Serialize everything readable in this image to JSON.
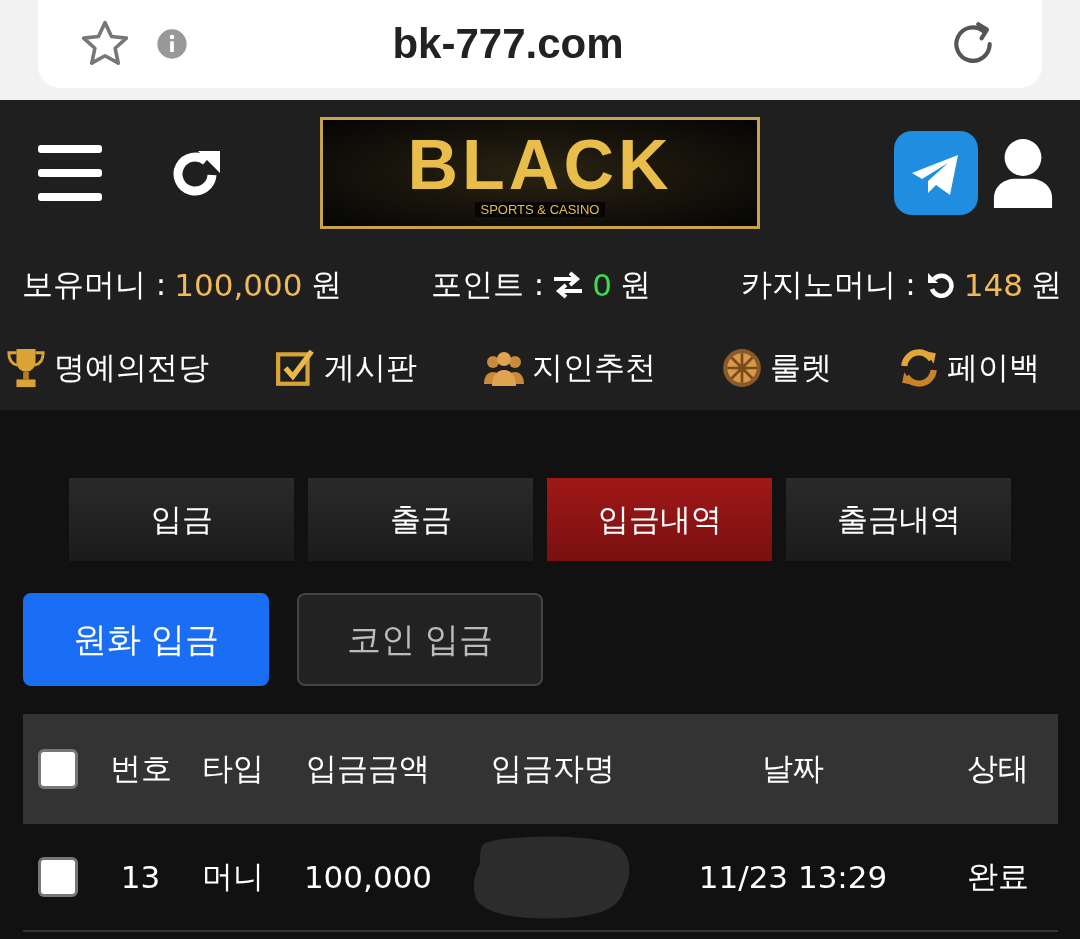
{
  "browser": {
    "url": "bk-777.com"
  },
  "logo": {
    "title": "BLACK",
    "subtitle": "SPORTS & CASINO"
  },
  "balances": [
    {
      "label": "보유머니 :",
      "value": "100,000",
      "unit": "원",
      "kind": "plain",
      "color": "#f0b95a"
    },
    {
      "label": "포인트 :",
      "value": "0",
      "unit": "원",
      "kind": "transfer",
      "color": "#3ddc4a"
    },
    {
      "label": "카지노머니 :",
      "value": "148",
      "unit": "원",
      "kind": "reload",
      "color": "#f0b95a"
    }
  ],
  "menu": [
    {
      "label": "명예의전당",
      "kind": "trophy"
    },
    {
      "label": "게시판",
      "kind": "board"
    },
    {
      "label": "지인추천",
      "kind": "people"
    },
    {
      "label": "룰렛",
      "kind": "wheel"
    },
    {
      "label": "페이백",
      "kind": "cycle"
    }
  ],
  "tabs": [
    {
      "label": "입금",
      "selected": false
    },
    {
      "label": "출금",
      "selected": false
    },
    {
      "label": "입금내역",
      "selected": true
    },
    {
      "label": "출금내역",
      "selected": false
    }
  ],
  "subtabs": [
    {
      "label": "원화 입금",
      "selected": true
    },
    {
      "label": "코인 입금",
      "selected": false
    }
  ],
  "table": {
    "header_checked": false,
    "columns": [
      "번호",
      "타입",
      "입금금액",
      "입금자명",
      "날짜",
      "상태"
    ],
    "rows": [
      {
        "checked": false,
        "cells": [
          "13",
          "머니",
          "100,000",
          null,
          "11/23 13:29",
          "완료"
        ]
      }
    ]
  }
}
